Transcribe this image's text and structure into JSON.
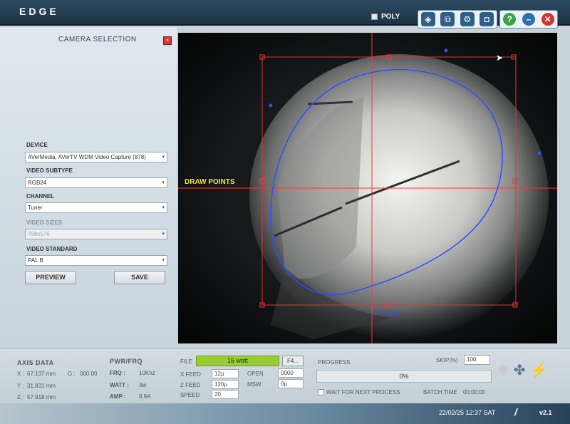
{
  "app": {
    "title": "EDGE"
  },
  "toolbar": {
    "poly_label": "POLY",
    "tools": [
      {
        "icon": "layers-icon",
        "glyph": "◈"
      },
      {
        "icon": "camera-settings-icon",
        "glyph": "⧉"
      },
      {
        "icon": "gear-icon",
        "glyph": "⚙"
      },
      {
        "icon": "camera-icon",
        "glyph": "◘"
      }
    ],
    "window_buttons": [
      {
        "icon": "help-icon",
        "glyph": "?",
        "color": "#3aa34a"
      },
      {
        "icon": "minimize-icon",
        "glyph": "–",
        "color": "#2f6fb0"
      },
      {
        "icon": "close-icon",
        "glyph": "✕",
        "color": "#d9332b"
      }
    ]
  },
  "camera_panel": {
    "title": "CAMERA SELECTION",
    "close_icon": "close-icon",
    "device_label": "DEVICE",
    "device_value": "AVerMedia, AVerTV WDM Video Capture (878)",
    "subtype_label": "VIDEO SUBTYPE",
    "subtype_value": "RGB24",
    "channel_label": "CHANNEL",
    "channel_value": "Tuner",
    "sizes_label": "VIDEO SIZES",
    "sizes_value": "768x576",
    "standard_label": "VIDEO STANDARD",
    "standard_value": "PAL B",
    "preview_label": "PREVIEW",
    "save_label": "SAVE"
  },
  "camera_view": {
    "draw_points_label": "DRAW POINTS",
    "coordinate_readout": "0.0(-0.00)",
    "crosshair_color": "#ff3333",
    "polygon_color": "#2b4fff"
  },
  "axis": {
    "title": "AXIS DATA",
    "x_label": "X :",
    "x_value": "67.137 mm",
    "y_label": "Y :",
    "y_value": "31.831 mm",
    "z_label": "Z :",
    "z_value": "57.918 mm",
    "g_label": "G :",
    "g_value": "000.00"
  },
  "power": {
    "title": "PWR/FRQ",
    "frq_label": "FRQ :",
    "frq_value": "10Khz",
    "watt_label": "WATT :",
    "watt_value": "3w",
    "amp_label": "AMP :",
    "amp_value": "8.9A"
  },
  "file": {
    "label": "FILE",
    "value": "16 watt",
    "f4_label": "F4...",
    "xfeed_label": "X FEED",
    "xfeed_value": "12µ",
    "zfeed_label": "Z FEED",
    "zfeed_value": "120µ",
    "speed_label": "SPEED",
    "speed_value": "20",
    "open_label": "OPEN",
    "open_value": "0000",
    "msw_label": "MSW",
    "msw_value": "0µ"
  },
  "progress": {
    "label": "PROGRESS",
    "value_text": "0%",
    "skip_label": "SKIP(%)",
    "skip_value": "100",
    "wait_label": "WAIT FOR NEXT PROCESS",
    "batch_label": "BATCH TIME",
    "batch_value": "00:00:00"
  },
  "status_icons": [
    {
      "icon": "sun-icon",
      "glyph": "✺",
      "color": "#c8c8c8"
    },
    {
      "icon": "fan-icon",
      "glyph": "✤",
      "color": "#5a7f9c"
    },
    {
      "icon": "lightning-icon",
      "glyph": "⚡",
      "color": "#f08a1c"
    }
  ],
  "status": {
    "datetime": "22/02/25 12:37 SAT",
    "version": "v2.1"
  }
}
